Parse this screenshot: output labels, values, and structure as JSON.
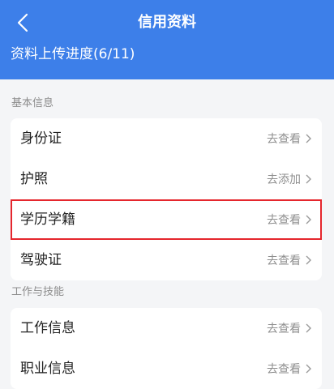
{
  "header": {
    "title": "信用资料",
    "progress": "资料上传进度(6/11)"
  },
  "sections": [
    {
      "title": "基本信息",
      "items": [
        {
          "label": "身份证",
          "action": "去查看"
        },
        {
          "label": "护照",
          "action": "去添加"
        },
        {
          "label": "学历学籍",
          "action": "去查看"
        },
        {
          "label": "驾驶证",
          "action": "去查看"
        }
      ]
    },
    {
      "title": "工作与技能",
      "items": [
        {
          "label": "工作信息",
          "action": "去查看"
        },
        {
          "label": "职业信息",
          "action": "去查看"
        }
      ]
    }
  ],
  "colors": {
    "header": "#3d7fe9",
    "highlight": "#e5262d"
  }
}
